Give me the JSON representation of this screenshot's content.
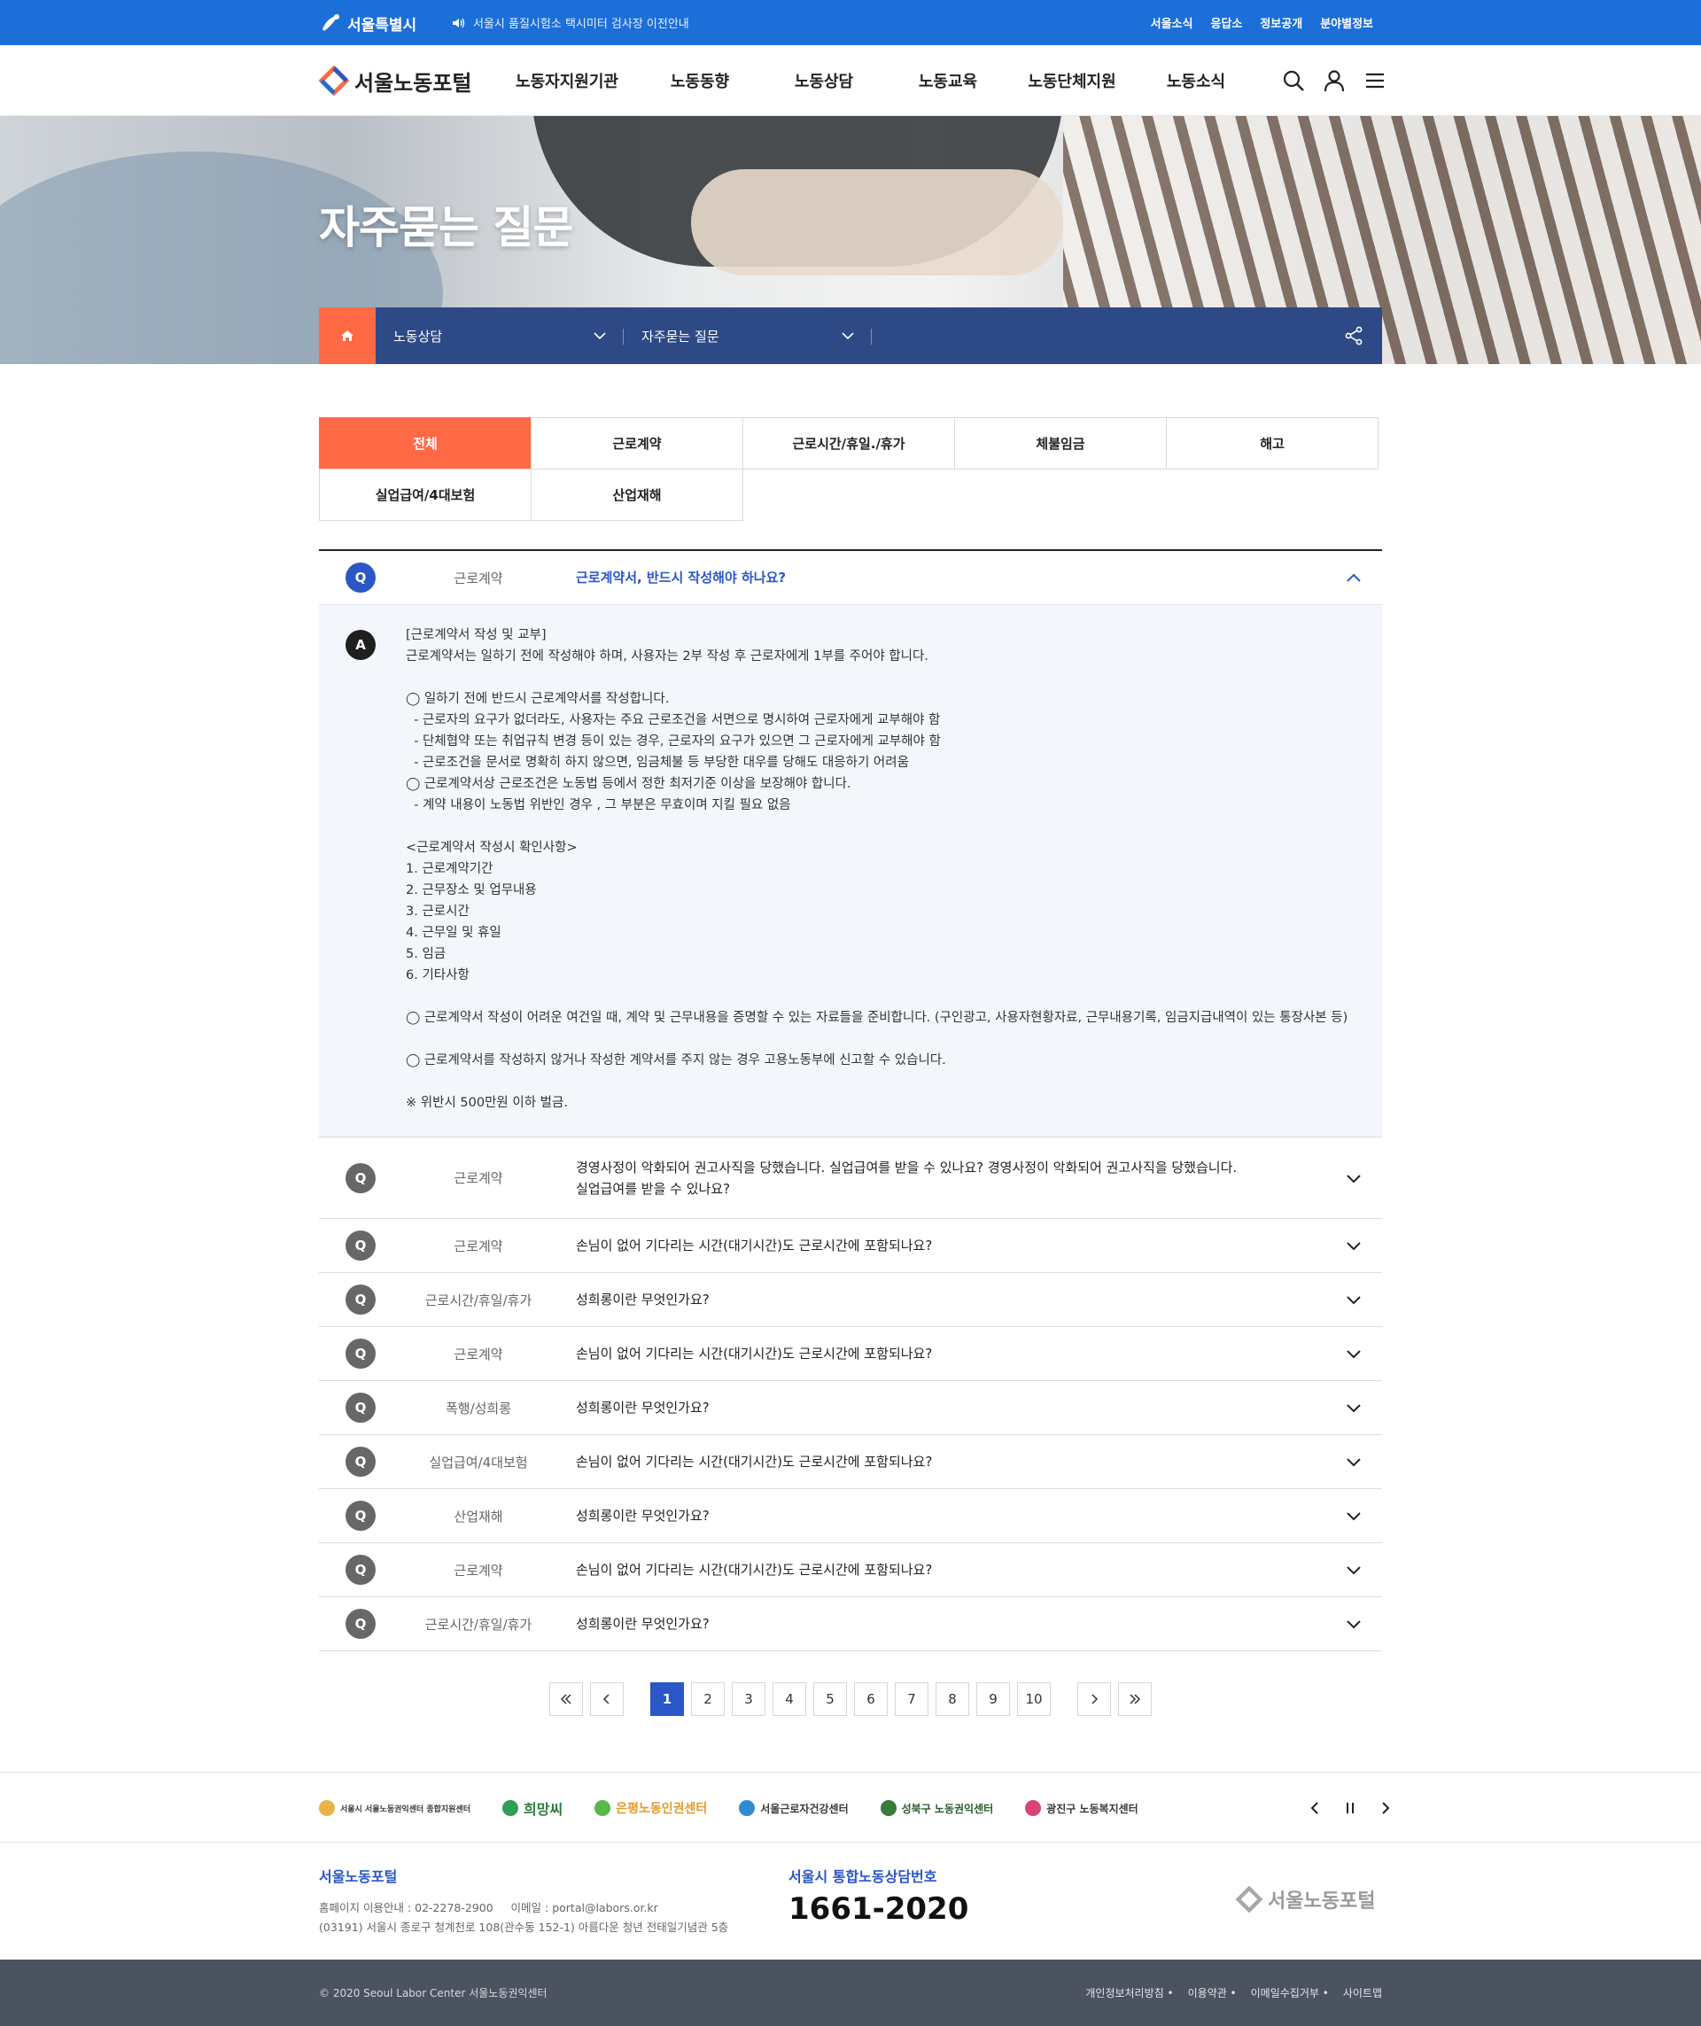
{
  "topbar": {
    "city_logo": "서울특별시",
    "notice": "서울시 품질시험소 택시미터 검사장 이전안내",
    "util_links": [
      "서울소식",
      "응답소",
      "정보공개",
      "분야별정보"
    ]
  },
  "header": {
    "logo_text": "서울노동포털",
    "menu": [
      "노동자지원기관",
      "노동동향",
      "노동상담",
      "노동교육",
      "노동단체지원",
      "노동소식"
    ]
  },
  "visual": {
    "title": "자주묻는 질문"
  },
  "location": {
    "depth1": "노동상담",
    "depth2": "자주묻는 질문"
  },
  "tabs": {
    "row1": [
      "전체",
      "근로계약",
      "근로시간/휴일./휴가",
      "체불임금",
      "해고"
    ],
    "row2": [
      "실업급여/4대보험",
      "산업재해"
    ],
    "active": "전체"
  },
  "faq": {
    "open": {
      "badge": "Q",
      "category": "근로계약",
      "question": "근로계약서, 반드시 작성해야 하나요?",
      "answer_badge": "A",
      "answer_lines": [
        "[근로계약서 작성 및 교부]",
        "근로계약서는 일하기 전에 작성해야 하며, 사용자는 2부 작성 후 근로자에게 1부를 주어야 합니다.",
        "",
        "◯ 일하기 전에 반드시 근로계약서를 작성합니다.",
        "  - 근로자의 요구가 없더라도, 사용자는 주요 근로조건을 서면으로 명시하여 근로자에게 교부해야 함",
        "  - 단체협약 또는 취업규칙 변경 등이 있는 경우, 근로자의 요구가 있으면 그 근로자에게 교부해야 함",
        "  - 근로조건을 문서로 명확히 하지 않으면, 임금체불 등 부당한 대우를 당해도 대응하기 어려움",
        "◯ 근로계약서상 근로조건은 노동법 등에서 정한 최저기준 이상을 보장해야 합니다.",
        "  - 계약 내용이 노동법 위반인 경우 , 그 부분은 무효이며 지킬 필요 없음",
        "",
        "<근로계약서 작성시 확인사항>",
        "1. 근로계약기간",
        "2. 근무장소 및 업무내용",
        "3. 근로시간",
        "4. 근무일 및 휴일",
        "5. 임금",
        "6. 기타사항",
        "",
        "◯ 근로계약서 작성이 어려운 여건일 때, 계약 및 근무내용을 증명할 수 있는 자료들을 준비합니다. (구인광고, 사용자현황자료, 근무내용기록, 임금지급내역이 있는 통장사본 등)",
        "",
        "◯ 근로계약서를 작성하지 않거나 작성한 계약서를 주지 않는 경우 고용노동부에 신고할 수 있습니다.",
        "",
        "※ 위반시 500만원 이하 벌금."
      ]
    },
    "items": [
      {
        "badge": "Q",
        "category": "근로계약",
        "question_l1": "경영사정이 악화되어 권고사직을 당했습니다. 실업급여를 받을 수 있나요? 경영사정이 악화되어 권고사직을 당했습니다.",
        "question_l2": "실업급여를 받을 수 있나요?"
      },
      {
        "badge": "Q",
        "category": "근로계약",
        "question": "손님이 없어 기다리는 시간(대기시간)도 근로시간에 포함되나요?"
      },
      {
        "badge": "Q",
        "category": "근로시간/휴일/휴가",
        "question": "성희롱이란 무엇인가요?"
      },
      {
        "badge": "Q",
        "category": "근로계약",
        "question": "손님이 없어 기다리는 시간(대기시간)도 근로시간에 포함되나요?"
      },
      {
        "badge": "Q",
        "category": "폭행/성희롱",
        "question": "성희롱이란 무엇인가요?"
      },
      {
        "badge": "Q",
        "category": "실업급여/4대보험",
        "question": "손님이 없어 기다리는 시간(대기시간)도 근로시간에 포함되나요?"
      },
      {
        "badge": "Q",
        "category": "산업재해",
        "question": "성희롱이란 무엇인가요?"
      },
      {
        "badge": "Q",
        "category": "근로계약",
        "question": "손님이 없어 기다리는 시간(대기시간)도 근로시간에 포함되나요?"
      },
      {
        "badge": "Q",
        "category": "근로시간/휴일/휴가",
        "question": "성희롱이란 무엇인가요?"
      }
    ]
  },
  "paging": {
    "pages": [
      "1",
      "2",
      "3",
      "4",
      "5",
      "6",
      "7",
      "8",
      "9",
      "10"
    ],
    "current": "1"
  },
  "family": {
    "orgs": [
      "서울시 서울노동권익센터 종합지원센터",
      "희망씨",
      "은평노동인권센터",
      "서울근로자건강센터",
      "성북구 노동권익센터",
      "광진구 노동복지센터"
    ]
  },
  "footer": {
    "name": "서울노동포털",
    "phone_line": "홈페이지 이용안내 : 02-2278-2900     이메일 : portal@labors.or.kr",
    "address": "(03191) 서울시 종로구 청계천로 108(관수동 152-1) 아름다운 청년 전태일기념관 5층",
    "hotline_title": "서울시 통합노동상담번호",
    "hotline": "1661-2020",
    "logo": "서울노동포털",
    "copyright": "© 2020 Seoul Labor Center 서울노동권익센터",
    "links": [
      "개인정보처리방침 •",
      "이용약관 •",
      "이메일수집거부 •",
      "사이트맵"
    ]
  },
  "colors": {
    "primary": "#1c6fd8",
    "navy": "#2e4a86",
    "accent": "#ff6a45",
    "link_blue": "#2a56c6",
    "footer_bottom": "#4b5361"
  }
}
